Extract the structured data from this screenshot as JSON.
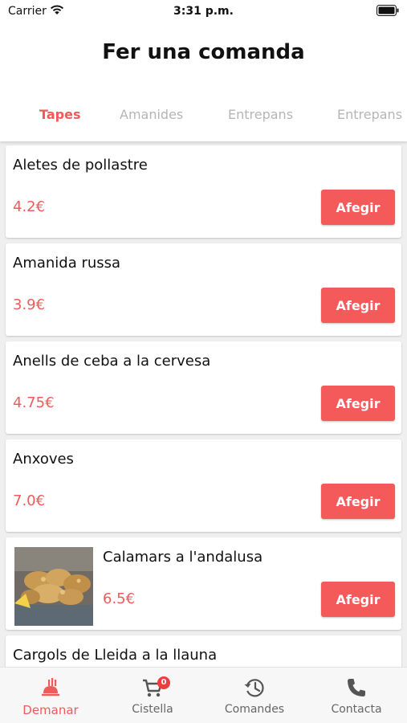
{
  "status_bar": {
    "carrier": "Carrier",
    "time": "3:31 p.m."
  },
  "header": {
    "title": "Fer una comanda"
  },
  "tabs": [
    {
      "label": "Tapes",
      "active": true
    },
    {
      "label": "Amanides",
      "active": false
    },
    {
      "label": "Entrepans",
      "active": false
    },
    {
      "label": "Entrepans",
      "active": false
    }
  ],
  "add_label": "Afegir",
  "items": [
    {
      "name": "Aletes de pollastre",
      "price": "4.2€"
    },
    {
      "name": "Amanida russa",
      "price": "3.9€"
    },
    {
      "name": "Anells de ceba a la cervesa",
      "price": "4.75€"
    },
    {
      "name": "Anxoves",
      "price": "7.0€"
    },
    {
      "name": "Calamars a l'andalusa",
      "price": "6.5€",
      "image": "fried-calamari-photo"
    },
    {
      "name": "Cargols de Lleida a la llauna",
      "price": ""
    }
  ],
  "tabbar": {
    "items": [
      {
        "label": "Demanar",
        "icon": "food-order-icon",
        "active": true
      },
      {
        "label": "Cistella",
        "icon": "cart-icon",
        "active": false,
        "badge": "0"
      },
      {
        "label": "Comandes",
        "icon": "history-icon",
        "active": false
      },
      {
        "label": "Contacta",
        "icon": "phone-icon",
        "active": false
      }
    ]
  },
  "colors": {
    "accent": "#f05a5a",
    "button": "#f55a5a",
    "inactive_tab": "#b5b5b5",
    "background": "#efefef"
  }
}
